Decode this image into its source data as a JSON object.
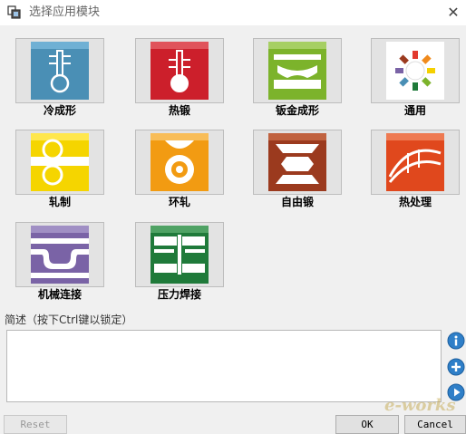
{
  "window": {
    "title": "选择应用模块",
    "close_glyph": "✕"
  },
  "modules": [
    {
      "label": "冷成形",
      "icon": "cold-forming-icon",
      "color": "#4a8fb5"
    },
    {
      "label": "热锻",
      "icon": "hot-forging-icon",
      "color": "#cc1f2b"
    },
    {
      "label": "钣金成形",
      "icon": "sheet-metal-forming-icon",
      "color": "#7cb32b"
    },
    {
      "label": "通用",
      "icon": "general-icon",
      "color": "#ffffff"
    },
    {
      "label": "轧制",
      "icon": "rolling-icon",
      "color": "#f5d500"
    },
    {
      "label": "环轧",
      "icon": "ring-rolling-icon",
      "color": "#f29b12"
    },
    {
      "label": "自由锻",
      "icon": "open-die-forging-icon",
      "color": "#9b3a1e"
    },
    {
      "label": "热处理",
      "icon": "heat-treatment-icon",
      "color": "#e0481d"
    },
    {
      "label": "机械连接",
      "icon": "mechanical-joining-icon",
      "color": "#7a63a6"
    },
    {
      "label": "压力焊接",
      "icon": "pressure-welding-icon",
      "color": "#1f7a3a"
    }
  ],
  "description": {
    "label": "简述（按下Ctrl键以锁定）",
    "value": ""
  },
  "side_buttons": [
    {
      "icon": "info-icon"
    },
    {
      "icon": "add-icon"
    },
    {
      "icon": "play-icon"
    }
  ],
  "buttons": {
    "reset": "Reset",
    "ok": "OK",
    "cancel": "Cancel"
  },
  "watermark": "e-works"
}
